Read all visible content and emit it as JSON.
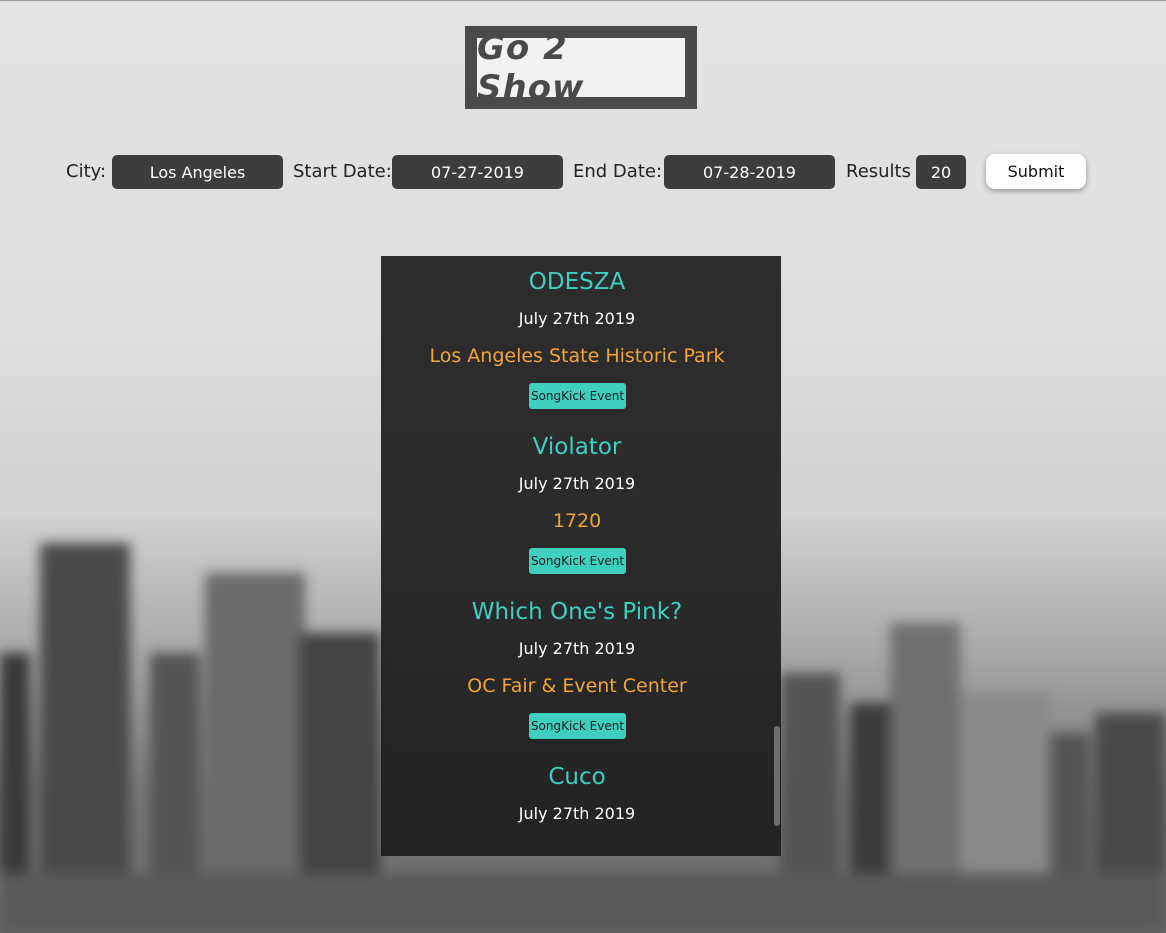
{
  "app": {
    "logo": "Go 2 Show"
  },
  "search": {
    "city_label": "City:",
    "city_value": "Los Angeles",
    "start_label": "Start Date:",
    "start_value": "07-27-2019",
    "end_label": "End Date:",
    "end_value": "07-28-2019",
    "results_label": "Results",
    "results_value": "20",
    "submit_label": "Submit"
  },
  "events": [
    {
      "name": "ODESZA",
      "date": "July 27th 2019",
      "venue": "Los Angeles State Historic Park",
      "link": "SongKick Event"
    },
    {
      "name": "Violator",
      "date": "July 27th 2019",
      "venue": "1720",
      "link": "SongKick Event"
    },
    {
      "name": "Which One's Pink?",
      "date": "July 27th 2019",
      "venue": "OC Fair & Event Center",
      "link": "SongKick Event"
    },
    {
      "name": "Cuco",
      "date": "July 27th 2019"
    }
  ],
  "colors": {
    "accent_teal": "#3ecfbf",
    "venue_orange": "#f2a43a",
    "panel_bg": "#1e1e1e",
    "field_bg": "#3d3d3d"
  }
}
